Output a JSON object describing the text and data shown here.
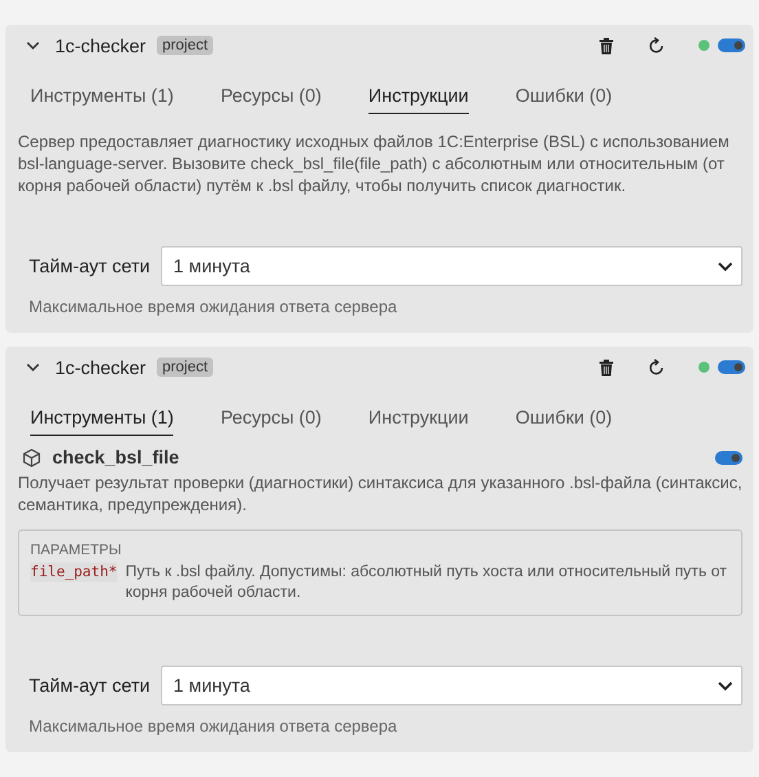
{
  "servers": [
    {
      "name": "1c-checker",
      "badge": "project",
      "expanded": true,
      "color": "#5cc27a",
      "enabled": true,
      "tabs": [
        {
          "label": "Инструменты (1)",
          "selected": false
        },
        {
          "label": "Ресурсы (0)",
          "selected": false
        },
        {
          "label": "Инструкции",
          "selected": true
        },
        {
          "label": "Ошибки (0)",
          "selected": false
        }
      ],
      "content": {
        "kind": "instructions",
        "text": "Сервер предоставляет диагностику исходных файлов 1C:Enterprise (BSL) с использованием bsl-language-server. Вызовите check_bsl_file(file_path) с абсолютным или относительным (от корня рабочей области) путём к .bsl файлу, чтобы получить список диагностик."
      },
      "setting": {
        "label": "Тайм-аут сети",
        "value": "1 минута",
        "hint": "Максимальное время ожидания ответа сервера"
      }
    },
    {
      "name": "1c-checker",
      "badge": "project",
      "expanded": true,
      "color": "#5cc27a",
      "enabled": true,
      "tabs": [
        {
          "label": "Инструменты (1)",
          "selected": true
        },
        {
          "label": "Ресурсы (0)",
          "selected": false
        },
        {
          "label": "Инструкции",
          "selected": false
        },
        {
          "label": "Ошибки (0)",
          "selected": false
        }
      ],
      "content": {
        "kind": "tools",
        "tools": [
          {
            "name": "check_bsl_file",
            "enabled": true,
            "description": "Получает результат проверки (диагностики) синтаксиса для указанного .bsl-файла (синтаксис, семантика, предупреждения).",
            "params_title": "ПАРАМЕТРЫ",
            "params": [
              {
                "name": "file_path*",
                "description": "Путь к .bsl файлу. Допустимы: абсолютный путь хоста или относительный путь от корня рабочей области."
              }
            ]
          }
        ]
      },
      "setting": {
        "label": "Тайм-аут сети",
        "value": "1 минута",
        "hint": "Максимальное время ожидания ответа сервера"
      }
    }
  ]
}
